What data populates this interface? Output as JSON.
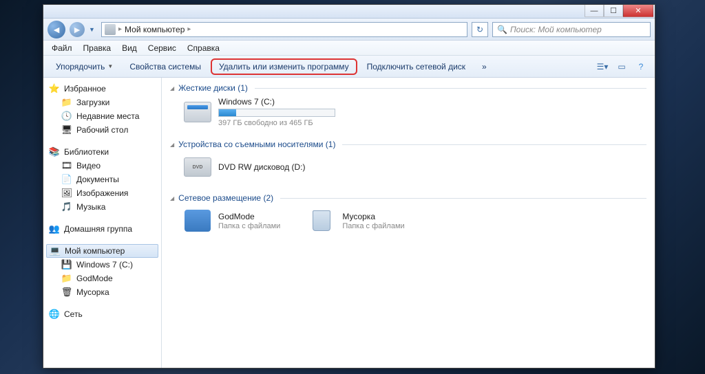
{
  "address": {
    "root": "Мой компьютер"
  },
  "search": {
    "placeholder": "Поиск: Мой компьютер"
  },
  "menu": {
    "file": "Файл",
    "edit": "Правка",
    "view": "Вид",
    "tools": "Сервис",
    "help": "Справка"
  },
  "toolbar": {
    "organize": "Упорядочить",
    "props": "Свойства системы",
    "uninstall": "Удалить или изменить программу",
    "netdrive": "Подключить сетевой диск",
    "more": "»"
  },
  "sidebar": {
    "favorites": {
      "label": "Избранное",
      "downloads": "Загрузки",
      "recent": "Недавние места",
      "desktop": "Рабочий стол"
    },
    "libraries": {
      "label": "Библиотеки",
      "video": "Видео",
      "docs": "Документы",
      "pics": "Изображения",
      "music": "Музыка"
    },
    "homegroup": "Домашняя группа",
    "computer": {
      "label": "Мой компьютер",
      "win7": "Windows 7 (C:)",
      "godmode": "GodMode",
      "trash": "Мусорка"
    },
    "network": "Сеть"
  },
  "sections": {
    "hdd": {
      "title": "Жесткие диски (1)",
      "win7": {
        "name": "Windows 7 (C:)",
        "info": "397 ГБ свободно из 465 ГБ",
        "percent": 15
      }
    },
    "removable": {
      "title": "Устройства со съемными носителями (1)",
      "dvd": {
        "name": "DVD RW дисковод (D:)"
      }
    },
    "network": {
      "title": "Сетевое размещение (2)",
      "godmode": {
        "name": "GodMode",
        "sub": "Папка с файлами"
      },
      "trash": {
        "name": "Мусорка",
        "sub": "Папка с файлами"
      }
    }
  }
}
